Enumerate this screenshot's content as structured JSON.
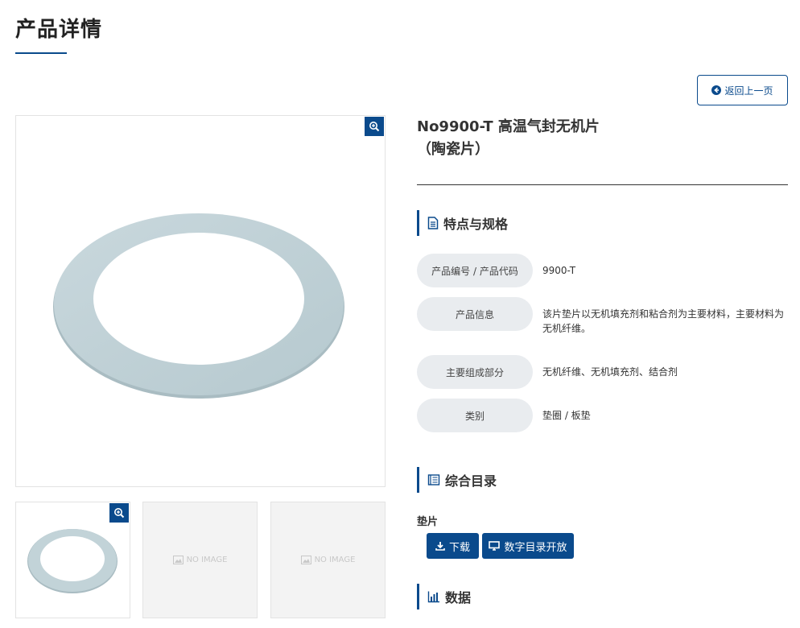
{
  "page": {
    "title": "产品详情"
  },
  "back_button": {
    "label": "返回上一页"
  },
  "product": {
    "title_line1": "No9900-T 高温气封无机片",
    "title_line2": "（陶瓷片）"
  },
  "sections": {
    "specs": {
      "title": "特点与规格"
    },
    "catalog": {
      "title": "综合目录"
    },
    "data": {
      "title": "数据"
    }
  },
  "specs": [
    {
      "label": "产品编号 / 产品代码",
      "value": "9900-T"
    },
    {
      "label": "产品信息",
      "value": "该片垫片以无机填充剂和粘合剂为主要材料，主要材料为无机纤维。"
    },
    {
      "label": "主要组成部分",
      "value": "无机纤维、无机填充剂、结合剂"
    },
    {
      "label": "类别",
      "value": "垫圈 / 板垫"
    }
  ],
  "catalog": {
    "category": "垫片",
    "download_label": "下载",
    "digital_label": "数字目录开放"
  },
  "thumbnails": {
    "no_image_text": "NO IMAGE"
  },
  "icons": {
    "zoom": "zoom-in-icon",
    "back": "arrow-circle-left-icon",
    "specs": "file-text-icon",
    "catalog": "book-icon",
    "data": "bar-chart-icon",
    "download": "download-icon",
    "digital": "monitor-icon"
  },
  "colors": {
    "accent": "#0a4a8c",
    "label_bg": "#e9ecef",
    "gasket": "#bfd0d6"
  }
}
